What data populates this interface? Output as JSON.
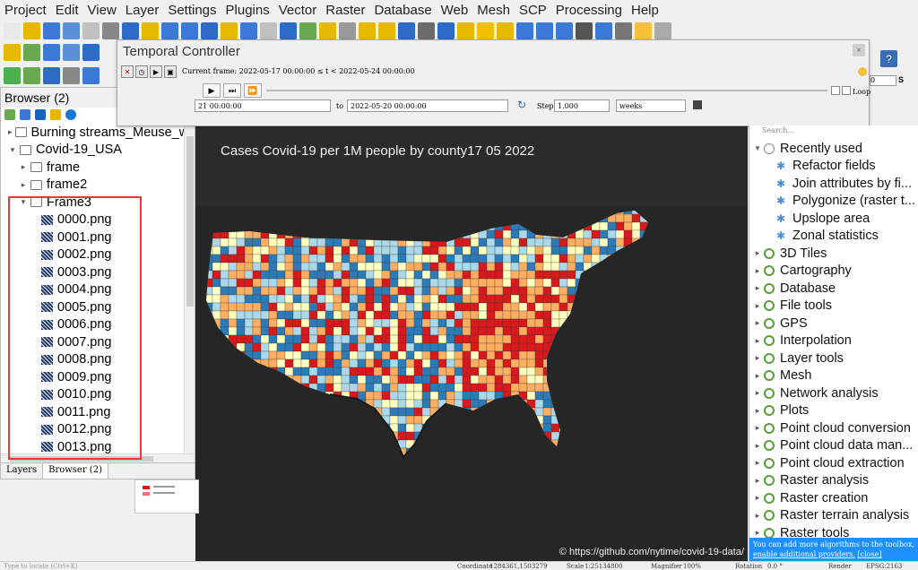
{
  "menu": [
    "Project",
    "Edit",
    "View",
    "Layer",
    "Settings",
    "Plugins",
    "Vector",
    "Raster",
    "Database",
    "Web",
    "Mesh",
    "SCP",
    "Processing",
    "Help"
  ],
  "browser": {
    "title": "Browser (2)",
    "close_label": "×",
    "tree": [
      {
        "label": "Burning streams_Meuse_w",
        "type": "folder",
        "expanded": false,
        "level": 0
      },
      {
        "label": "Covid-19_USA",
        "type": "folder",
        "expanded": true,
        "level": 0
      },
      {
        "label": "frame",
        "type": "folder",
        "expanded": false,
        "level": 1
      },
      {
        "label": "frame2",
        "type": "folder",
        "expanded": false,
        "level": 1
      },
      {
        "label": "Frame3",
        "type": "folder",
        "expanded": true,
        "level": 1
      },
      {
        "label": "0000.png",
        "type": "png",
        "level": 2
      },
      {
        "label": "0001.png",
        "type": "png",
        "level": 2
      },
      {
        "label": "0002.png",
        "type": "png",
        "level": 2
      },
      {
        "label": "0003.png",
        "type": "png",
        "level": 2
      },
      {
        "label": "0004.png",
        "type": "png",
        "level": 2
      },
      {
        "label": "0005.png",
        "type": "png",
        "level": 2
      },
      {
        "label": "0006.png",
        "type": "png",
        "level": 2
      },
      {
        "label": "0007.png",
        "type": "png",
        "level": 2
      },
      {
        "label": "0008.png",
        "type": "png",
        "level": 2
      },
      {
        "label": "0009.png",
        "type": "png",
        "level": 2
      },
      {
        "label": "0010.png",
        "type": "png",
        "level": 2
      },
      {
        "label": "0011.png",
        "type": "png",
        "level": 2
      },
      {
        "label": "0012.png",
        "type": "png",
        "level": 2
      },
      {
        "label": "0013.png",
        "type": "png",
        "level": 2
      }
    ],
    "tabs": [
      "Layers",
      "Browser (2)"
    ]
  },
  "temporal": {
    "title": "Temporal Controller",
    "current_frame": "Current frame: 2022-05-17 00:00:00 ≤ t < 2022-05-24 00:00:00",
    "loop_label": "Loop",
    "range_start": "21 00:00:00",
    "to_label": "to",
    "range_end": "2022-05-20 00:00:00",
    "step_label": "Step",
    "step_value": "1.000",
    "step_unit": "weeks"
  },
  "map": {
    "title": "Cases Covid-19 per 1M people by county17 05 2022",
    "credit": "© https://github.com/nytime/covid-19-data/"
  },
  "toolbox": {
    "search_placeholder": "Search...",
    "recent_label": "Recently used",
    "recent_items": [
      "Refactor fields",
      "Join attributes by fi...",
      "Polygonize (raster t...",
      "Upslope area",
      "Zonal statistics"
    ],
    "groups": [
      "3D Tiles",
      "Cartography",
      "Database",
      "File tools",
      "GPS",
      "Interpolation",
      "Layer tools",
      "Mesh",
      "Network analysis",
      "Plots",
      "Point cloud conversion",
      "Point cloud data man...",
      "Point cloud extraction",
      "Raster analysis",
      "Raster creation",
      "Raster terrain analysis",
      "Raster tools"
    ],
    "notice_text": "You can add more algorithms to the toolbox,",
    "notice_link": "enable additional providers.",
    "notice_close": "[close]"
  },
  "statusbar": {
    "locate_placeholder": "Type to locate (Ctrl+K)",
    "coordinate_label": "Coordinate",
    "coordinate_value": "1284361,1503279",
    "scale_label": "Scale",
    "scale_value": "1:25134800",
    "magnifier_label": "Magnifier",
    "magnifier_value": "100%",
    "rotation_label": "Rotation",
    "rotation_value": "0.0 °",
    "render_label": "Render",
    "crs_label": "EPSG:2163"
  },
  "colors": {
    "map_bg": "#262626",
    "choropleth": [
      "#2c7bb6",
      "#abd9e9",
      "#ffffbf",
      "#fdae61",
      "#d7191c"
    ],
    "highlight": "#e53935",
    "notice_bg": "#1e90ff"
  }
}
